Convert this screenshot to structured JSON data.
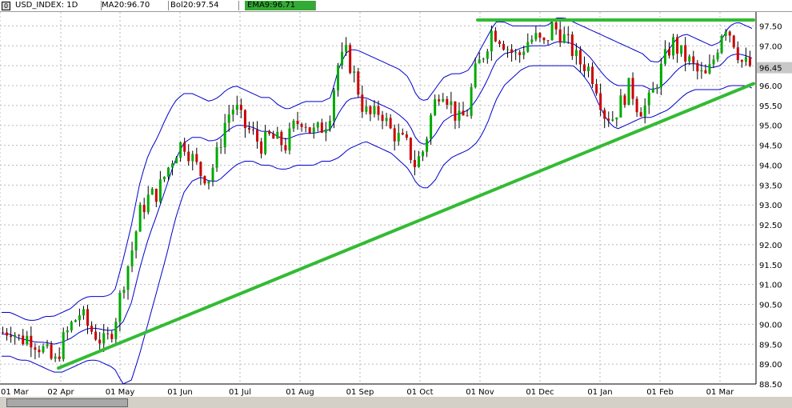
{
  "header": {
    "icon": "0",
    "symbol": "USD_INDEX: 1D",
    "ma": "MA20:96.70",
    "bol": "Bol20:97.54",
    "ema": "EMA9:96.71"
  },
  "colors": {
    "up": "#00aa00",
    "down": "#cc0000",
    "wick": "#000000",
    "bollinger": "#0000cc",
    "ma": "#228822",
    "trendline": "#33bb33",
    "grid": "#bbbbbb",
    "last_price_bg": "#c8c8c8"
  },
  "chart_data": {
    "type": "candlestick",
    "ylim": [
      88.5,
      97.85
    ],
    "y_ticks": [
      "97.50",
      "97.00",
      "96.50",
      "96.00",
      "95.50",
      "95.00",
      "94.50",
      "94.00",
      "93.50",
      "93.00",
      "92.50",
      "92.00",
      "91.50",
      "91.00",
      "90.50",
      "90.00",
      "89.50",
      "89.00",
      "88.50"
    ],
    "x_labels": [
      "01 Mar",
      "02 Apr",
      "01 May",
      "01 Jun",
      "01 Jul",
      "01 Aug",
      "01 Sep",
      "01 Oct",
      "01 Nov",
      "01 Dec",
      "01 Jan",
      "01 Feb",
      "01 Mar"
    ],
    "last_price": "96.45",
    "close_path": [
      89.8,
      89.9,
      89.6,
      89.7,
      89.5,
      89.3,
      89.0,
      89.6,
      90.0,
      90.3,
      89.9,
      89.7,
      89.5,
      90.0,
      91.0,
      91.8,
      92.8,
      93.2,
      93.3,
      93.8,
      94.3,
      94.6,
      94.2,
      93.8,
      93.7,
      94.3,
      95.2,
      95.5,
      95.0,
      94.8,
      94.5,
      94.7,
      94.6,
      94.5,
      95.0,
      95.2,
      94.8,
      94.9,
      95.2,
      96.5,
      96.8,
      96.2,
      95.4,
      95.2,
      95.4,
      94.9,
      94.7,
      94.5,
      94.0,
      94.4,
      95.4,
      96.0,
      95.6,
      95.1,
      95.3,
      96.3,
      96.8,
      97.4,
      97.2,
      96.9,
      96.7,
      97.1,
      97.2,
      97.0,
      97.5,
      97.3,
      97.0,
      96.6,
      96.5,
      96.1,
      95.3,
      95.2,
      95.6,
      96.0,
      95.4,
      95.5,
      96.0,
      96.6,
      97.1,
      96.8,
      96.6,
      96.3,
      96.2,
      96.8,
      97.6,
      97.2,
      96.6,
      96.5
    ],
    "bollinger_upper": [
      90.3,
      90.3,
      90.2,
      90.1,
      90.1,
      90.2,
      90.2,
      90.3,
      90.4,
      90.6,
      90.7,
      90.7,
      90.7,
      90.8,
      91.6,
      92.5,
      93.6,
      94.3,
      94.7,
      95.2,
      95.6,
      95.8,
      95.8,
      95.7,
      95.6,
      95.7,
      95.9,
      96.0,
      95.9,
      95.8,
      95.7,
      95.7,
      95.5,
      95.4,
      95.5,
      95.6,
      95.6,
      95.6,
      95.7,
      96.5,
      96.9,
      96.9,
      96.8,
      96.7,
      96.6,
      96.5,
      96.4,
      96.2,
      95.7,
      95.6,
      95.9,
      96.2,
      96.3,
      96.3,
      96.4,
      96.8,
      97.2,
      97.6,
      97.6,
      97.5,
      97.5,
      97.5,
      97.5,
      97.5,
      97.7,
      97.7,
      97.6,
      97.5,
      97.4,
      97.3,
      97.2,
      97.1,
      97.0,
      96.9,
      96.8,
      96.6,
      96.6,
      96.9,
      97.2,
      97.3,
      97.2,
      97.1,
      97.0,
      97.1,
      97.5,
      97.6,
      97.5,
      97.4
    ],
    "bollinger_lower": [
      89.2,
      89.2,
      89.1,
      89.1,
      89.0,
      88.9,
      88.8,
      88.8,
      88.9,
      89.0,
      89.1,
      89.1,
      89.0,
      88.9,
      88.5,
      88.6,
      89.3,
      90.1,
      90.9,
      91.7,
      92.6,
      93.3,
      93.6,
      93.7,
      93.6,
      93.6,
      93.8,
      94.0,
      94.1,
      94.1,
      94.0,
      94.0,
      93.9,
      93.9,
      94.0,
      94.0,
      94.0,
      94.1,
      94.1,
      94.2,
      94.4,
      94.5,
      94.6,
      94.5,
      94.4,
      94.3,
      94.1,
      93.9,
      93.5,
      93.4,
      93.6,
      94.0,
      94.2,
      94.3,
      94.4,
      94.6,
      95.0,
      95.6,
      96.0,
      96.2,
      96.4,
      96.5,
      96.5,
      96.5,
      96.5,
      96.5,
      96.5,
      96.3,
      96.0,
      95.5,
      95.1,
      94.9,
      95.0,
      95.1,
      95.2,
      95.2,
      95.3,
      95.4,
      95.6,
      95.8,
      95.9,
      95.9,
      95.9,
      95.9,
      96.0,
      96.0,
      96.0,
      95.9
    ],
    "trendlines": [
      {
        "from": [
          "02 Apr",
          88.9
        ],
        "to": [
          "01 Mar",
          96.05
        ]
      },
      {
        "from": [
          "01 Nov",
          97.65
        ],
        "to": [
          "01 Mar",
          97.65
        ]
      }
    ]
  }
}
